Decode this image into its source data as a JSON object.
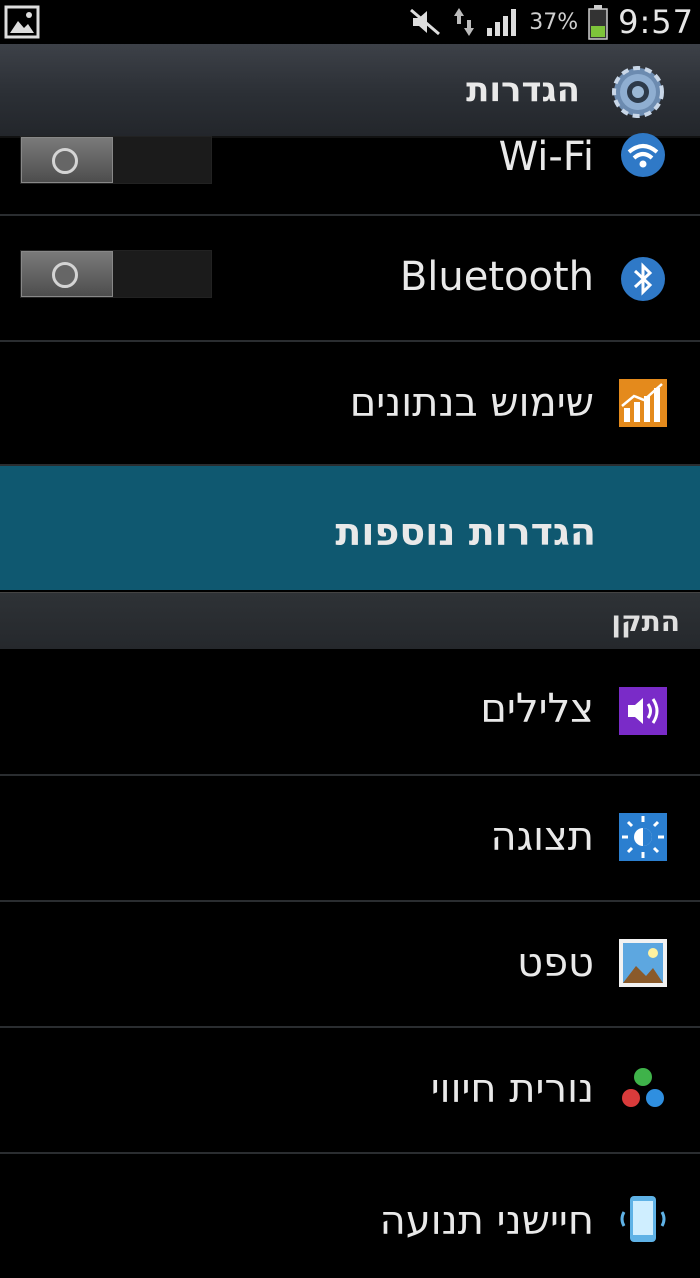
{
  "status_bar": {
    "battery_percent": "37%",
    "time": "9:57",
    "icons": [
      "gallery-icon",
      "mute-icon",
      "data-icon",
      "signal-icon",
      "battery-icon"
    ]
  },
  "header": {
    "title": "הגדרות",
    "icon": "gear-icon"
  },
  "settings": {
    "wifi": {
      "label": "Wi-Fi",
      "icon": "wifi-icon",
      "enabled": false
    },
    "bluetooth": {
      "label": "Bluetooth",
      "icon": "bluetooth-icon",
      "enabled": false
    },
    "data_usage": {
      "label": "שימוש בנתונים",
      "icon": "data-usage-icon"
    },
    "more_settings": {
      "label": "הגדרות נוספות"
    }
  },
  "section_device": {
    "title": "התקן",
    "items": [
      {
        "label": "צלילים",
        "icon": "sound-icon"
      },
      {
        "label": "תצוגה",
        "icon": "display-icon"
      },
      {
        "label": "טפט",
        "icon": "wallpaper-icon"
      },
      {
        "label": "נורית חיווי",
        "icon": "indicator-light-icon"
      },
      {
        "label": "חיישני תנועה",
        "icon": "motion-sensor-icon"
      }
    ]
  },
  "colors": {
    "highlight": "#0f5870",
    "title_bar": "#2b2f35",
    "background": "#000000"
  }
}
